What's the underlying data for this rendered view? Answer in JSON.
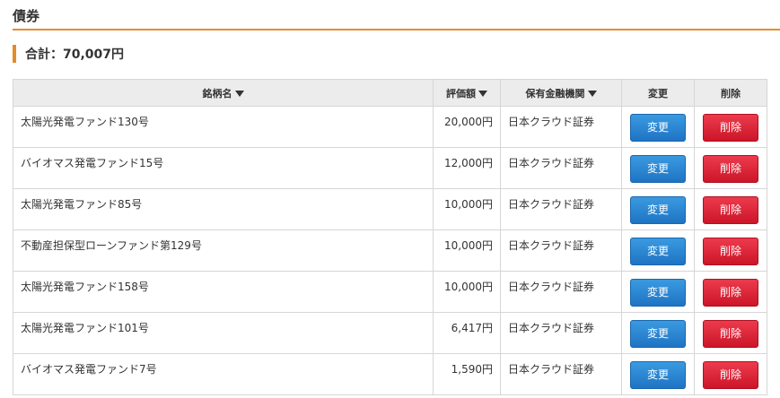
{
  "section": {
    "title": "債券"
  },
  "summary": {
    "total_label": "合計：70,007円"
  },
  "table": {
    "headers": {
      "name": "銘柄名",
      "value": "評価額",
      "institution": "保有金融機関",
      "edit": "変更",
      "delete": "削除"
    },
    "rows": [
      {
        "name": "太陽光発電ファンド130号",
        "value": "20,000円",
        "institution": "日本クラウド証券",
        "edit": "変更",
        "delete": "削除"
      },
      {
        "name": "バイオマス発電ファンド15号",
        "value": "12,000円",
        "institution": "日本クラウド証券",
        "edit": "変更",
        "delete": "削除"
      },
      {
        "name": "太陽光発電ファンド85号",
        "value": "10,000円",
        "institution": "日本クラウド証券",
        "edit": "変更",
        "delete": "削除"
      },
      {
        "name": "不動産担保型ローンファンド第129号",
        "value": "10,000円",
        "institution": "日本クラウド証券",
        "edit": "変更",
        "delete": "削除"
      },
      {
        "name": "太陽光発電ファンド158号",
        "value": "10,000円",
        "institution": "日本クラウド証券",
        "edit": "変更",
        "delete": "削除"
      },
      {
        "name": "太陽光発電ファンド101号",
        "value": "6,417円",
        "institution": "日本クラウド証券",
        "edit": "変更",
        "delete": "削除"
      },
      {
        "name": "バイオマス発電ファンド7号",
        "value": "1,590円",
        "institution": "日本クラウド証券",
        "edit": "変更",
        "delete": "削除"
      }
    ]
  },
  "colors": {
    "accent": "#e58b2a",
    "edit_button": "#1f74c4",
    "delete_button": "#cc1528",
    "header_bg": "#ececec"
  },
  "icons": {
    "sort": "sort-down-triangle-icon"
  }
}
